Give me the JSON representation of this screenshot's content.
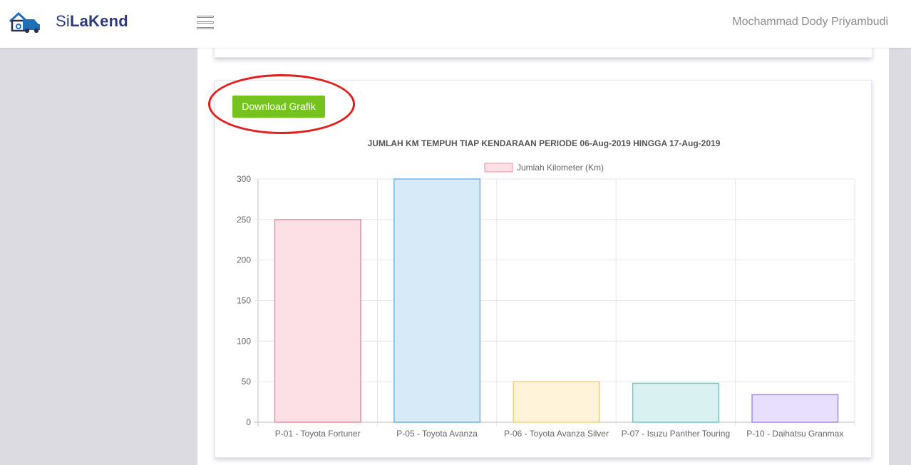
{
  "header": {
    "brand_prefix": "Si",
    "brand_bold": "LaKend",
    "username": "Mochammad Dody Priyambudi"
  },
  "actions": {
    "download_label": "Download Grafik"
  },
  "chart_data": {
    "type": "bar",
    "title": "JUMLAH KM TEMPUH TIAP KENDARAAN PERIODE 06-Aug-2019 HINGGA 17-Aug-2019",
    "legend": "Jumlah Kilometer (Km)",
    "legend_placement": "top",
    "categories": [
      "P-01 - Toyota Fortuner",
      "P-05 - Toyota Avanza",
      "P-06 - Toyota Avanza Silver",
      "P-07 - Isuzu Panther Touring",
      "P-10 - Daihatsu Granmax"
    ],
    "values": [
      250,
      300,
      50,
      48,
      34
    ],
    "ylim": [
      0,
      300
    ],
    "yticks": [
      "0",
      "50",
      "100",
      "150",
      "200",
      "250",
      "300"
    ],
    "grid": true,
    "fill_colors": [
      "#fde0e6",
      "#d6eaf8",
      "#fff3da",
      "#d9f1f1",
      "#e8defe"
    ],
    "stroke_colors": [
      "#e98fa4",
      "#6eb4e6",
      "#f2d07a",
      "#6fcaca",
      "#a58ae8"
    ],
    "legend_fill": "#fde0e6",
    "legend_stroke": "#e98fa4"
  }
}
